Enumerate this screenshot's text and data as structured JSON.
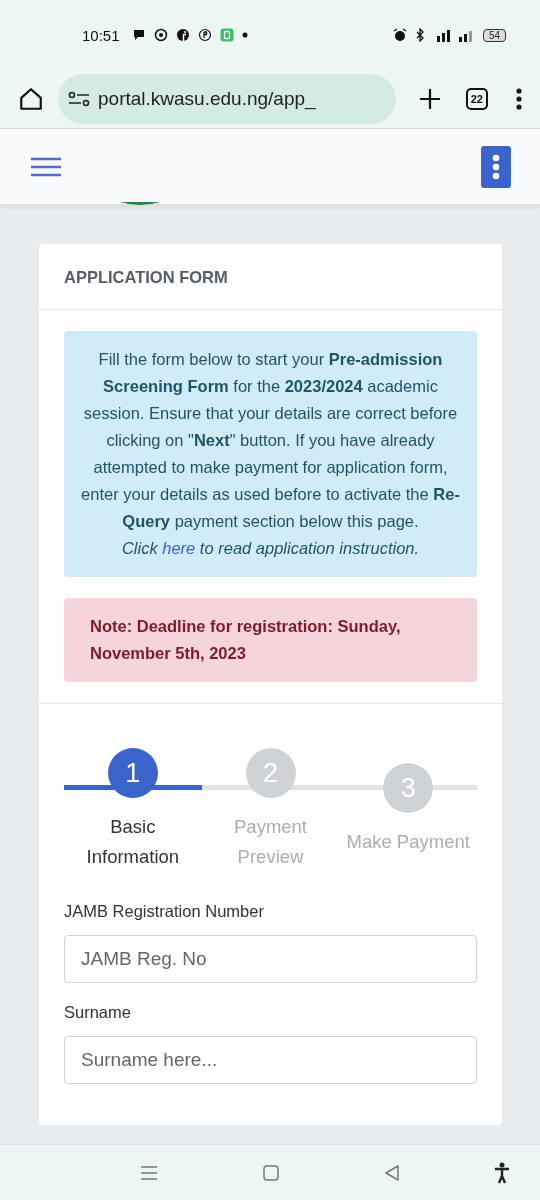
{
  "status_bar": {
    "time": "10:51",
    "battery": "54"
  },
  "browser": {
    "url": "portal.kwasu.edu.ng/app_",
    "tab_count": "22"
  },
  "card": {
    "title": "APPLICATION FORM",
    "info": {
      "text": "Fill the form below to start your **Pre-admission Screening Form** for the **2023/2024** academic session. Ensure that your details are correct before clicking on \"**Next**\" button. If you have already attempted to make payment for application form, enter your details as used before to activate the **Re-Query** payment section below this page.",
      "instruction_before": "Click",
      "instruction_link": "here",
      "instruction_after": "to read application instruction."
    },
    "note": "Note: Deadline for registration: Sunday, November 5th, 2023",
    "stepper": {
      "level": 0.333,
      "steps": [
        {
          "number": "1",
          "label": "Basic Information",
          "active": true
        },
        {
          "number": "2",
          "label": "Payment Preview",
          "active": false
        },
        {
          "number": "3",
          "label": "Make Payment",
          "active": false
        }
      ]
    },
    "fields": [
      {
        "label": "JAMB Registration Number",
        "placeholder": "JAMB Reg. No"
      },
      {
        "label": "Surname",
        "placeholder": "Surname here..."
      }
    ]
  }
}
